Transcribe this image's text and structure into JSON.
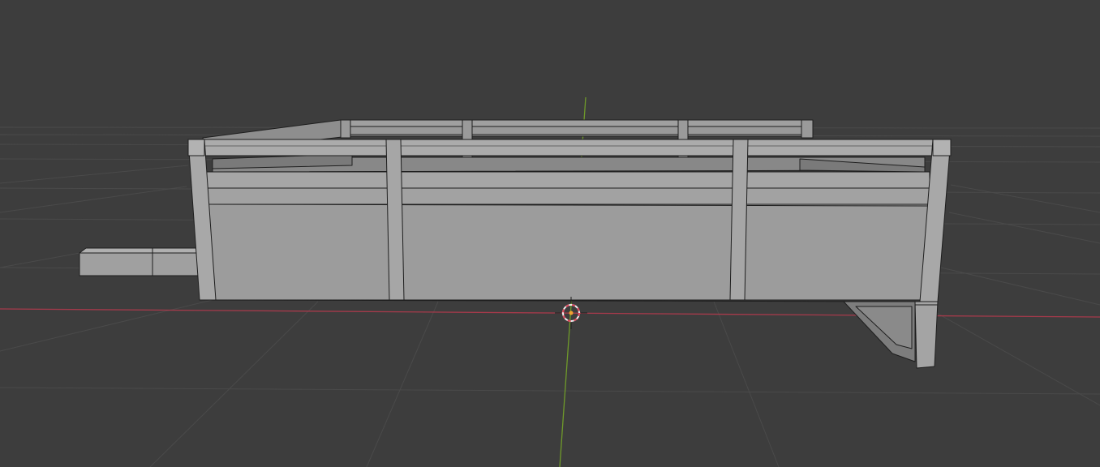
{
  "app": "3D viewport",
  "colors": {
    "background": "#3d3d3d",
    "grid_line": "#4a4a4a",
    "x_axis": "#a63a4b",
    "y_axis": "#6f9a2a",
    "mesh_face": "#9c9c9c",
    "mesh_face_light": "#a9a9a9",
    "mesh_face_dark": "#7d7d7d",
    "mesh_edge": "#1e1e1e",
    "cursor_ring_red": "#e0455a",
    "cursor_ring_white": "#f0f0f0",
    "origin_dot": "#f0a030"
  },
  "scene": {
    "objects": [
      {
        "name": "truck-bed-mesh",
        "shading": "solid",
        "selected": false
      }
    ],
    "overlays": {
      "floor_grid": true,
      "x_axis_line": true,
      "y_axis_line": true,
      "3d_cursor": true,
      "object_origin": true
    }
  }
}
